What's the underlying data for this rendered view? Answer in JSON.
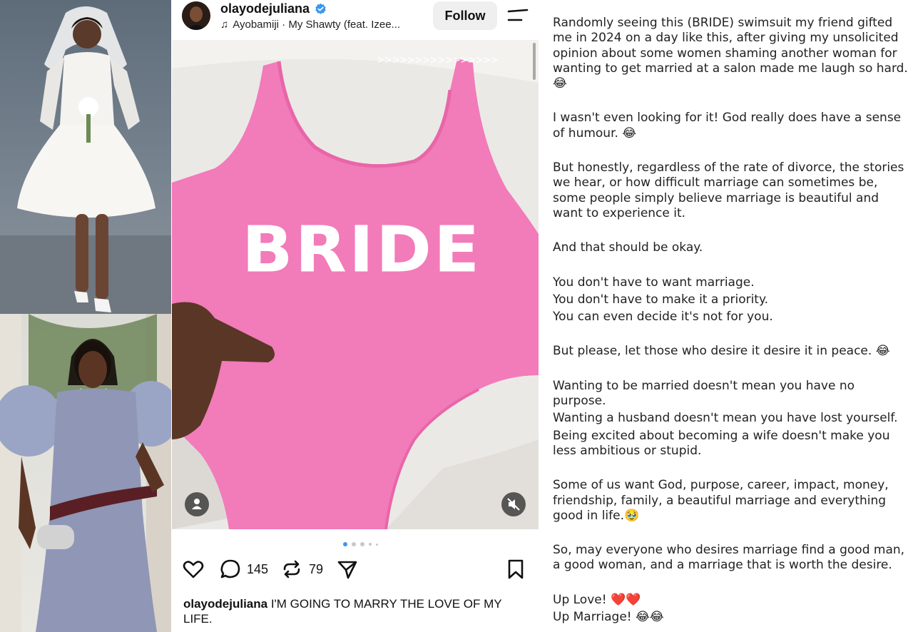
{
  "post": {
    "username": "olayodejuliana",
    "music": "Ayobamiji · My Shawty (feat. Izee...",
    "follow_label": "Follow",
    "overlay_arrows": ">>>>>>>>>>>>>>>>",
    "garment_print": "BRIDE",
    "carousel_dot_count": 5,
    "carousel_active_index": 0,
    "comments_count": "145",
    "reposts_count": "79",
    "caption_user": "olayodejuliana",
    "caption_text": " I'M  GOING TO MARRY THE LOVE OF MY LIFE."
  },
  "article": {
    "p1": "Randomly seeing this (BRIDE) swimsuit my friend gifted me in 2024 on a day like this, after giving my unsolicited opinion about some women shaming another woman for wanting to get married at a salon made me laugh so hard. 😂",
    "p2": "I wasn't even looking for it! God really does have a sense of humour. 😂",
    "p3": "But honestly, regardless of the rate of divorce, the stories we hear, or how difficult marriage can sometimes be, some people simply believe marriage is beautiful and want to experience it.",
    "p4": "And that should be okay.",
    "p5a": "You don't have to want marriage.",
    "p5b": "You don't have to make it a priority.",
    "p5c": "You can even decide it's not for you.",
    "p6": "But please, let those who desire it desire it in peace. 😂",
    "p7a": "Wanting to be married doesn't mean you have no purpose.",
    "p7b": "Wanting a husband doesn't mean you have lost yourself.",
    "p7c": "Being excited about becoming a wife doesn't make you less ambitious or stupid.",
    "p8": "Some of us want God, purpose, career, impact, money, friendship, family, a beautiful marriage and everything good in life.🥹",
    "p9": "So, may everyone who desires marriage find a good man, a good woman, and a marriage that is worth the desire.",
    "p10a": "Up Love! ❤️❤️",
    "p10b": "Up Marriage! 😂😂"
  },
  "colors": {
    "swimsuit_pink": "#f27bb9",
    "verified_blue": "#3897f0",
    "follow_bg": "#efefef"
  },
  "icons": [
    "verified-icon",
    "music-note-icon",
    "menu-icon",
    "tag-people-icon",
    "mute-icon",
    "heart-icon",
    "comment-icon",
    "repost-icon",
    "share-icon",
    "bookmark-icon"
  ]
}
